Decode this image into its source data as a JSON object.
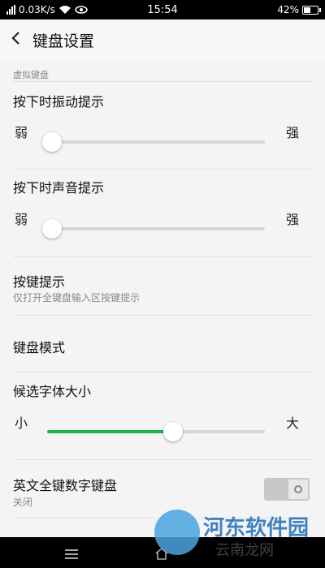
{
  "status_bar": {
    "speed": "0.03K/s",
    "time": "15:54",
    "battery": "42%",
    "battery_level": 0.42
  },
  "header": {
    "back_icon": "chevron-left-icon",
    "title": "键盘设置"
  },
  "section": {
    "label": "虚拟键盘"
  },
  "vibration": {
    "title": "按下时振动提示",
    "min_label": "弱",
    "max_label": "强",
    "value": 0.0
  },
  "sound": {
    "title": "按下时声音提示",
    "min_label": "弱",
    "max_label": "强",
    "value": 0.0
  },
  "key_hint": {
    "title": "按键提示",
    "subtitle": "仅打开全键盘输入区按键提示"
  },
  "keyboard_mode": {
    "title": "键盘模式"
  },
  "candidate_font": {
    "title": "候选字体大小",
    "min_label": "小",
    "max_label": "大",
    "value": 0.57
  },
  "en_numeric": {
    "title": "英文全键数字键盘",
    "subtitle": "关闭",
    "enabled": false
  },
  "watermark": {
    "line1": "河东软件园",
    "line2": "云南龙网"
  },
  "colors": {
    "accent": "#21b24c",
    "background": "#f4f4f4"
  }
}
